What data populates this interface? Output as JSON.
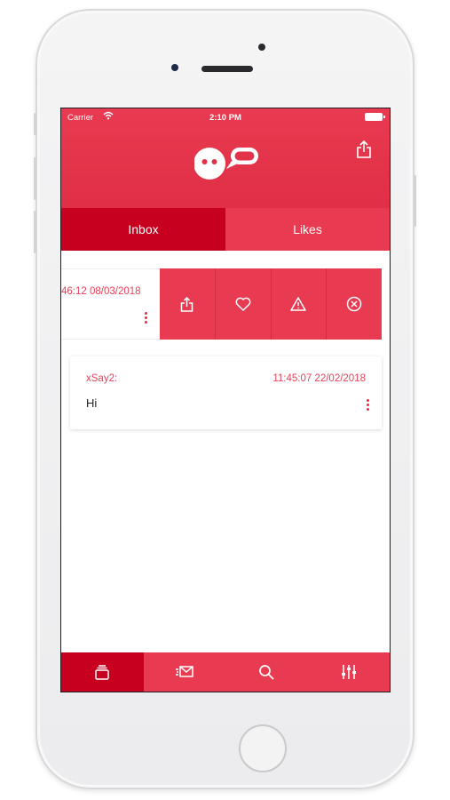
{
  "status_bar": {
    "carrier": "Carrier",
    "time": "2:10 PM"
  },
  "tabs": [
    {
      "label": "Inbox",
      "active": true
    },
    {
      "label": "Likes",
      "active": false
    }
  ],
  "messages": [
    {
      "timestamp": "46:12 08/03/2018",
      "swiped": true
    },
    {
      "sender": "xSay2:",
      "timestamp": "11:45:07 22/02/2018",
      "text": "Hi"
    }
  ],
  "row_actions": [
    "share-icon",
    "heart-icon",
    "warning-icon",
    "close-circle-icon"
  ],
  "bottom_nav": [
    "inbox-tray-icon",
    "compose-message-icon",
    "search-icon",
    "sliders-icon"
  ],
  "colors": {
    "primary": "#e83a50",
    "primary_dark": "#c8001f",
    "accent_text": "#e8415a"
  }
}
